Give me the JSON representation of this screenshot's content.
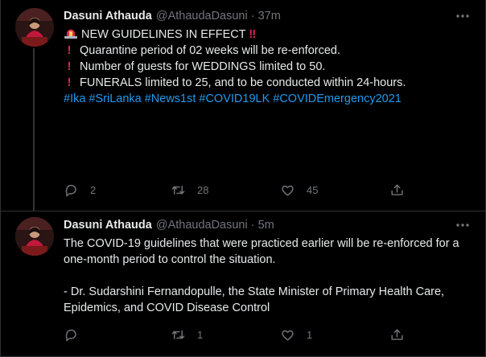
{
  "tweets": [
    {
      "author_name": "Dasuni Athauda",
      "author_handle": "@AthaudaDasuni",
      "separator": "·",
      "time": "37m",
      "headline_emoji_left": "siren-icon",
      "headline": "NEW GUIDELINES IN EFFECT",
      "headline_emoji_right": "double-exclamation-icon",
      "bullets": [
        "Quarantine period of 02 weeks will be re-enforced.",
        "Number of guests for WEDDINGS limited to 50.",
        "FUNERALS limited to 25, and to be conducted within 24-hours."
      ],
      "hashtags": [
        "#Ika",
        "#SriLanka",
        "#News1st",
        "#COVID19LK",
        "#COVIDEmergency2021"
      ],
      "reply_count": "2",
      "retweet_count": "28",
      "like_count": "45"
    },
    {
      "author_name": "Dasuni Athauda",
      "author_handle": "@AthaudaDasuni",
      "separator": "·",
      "time": "5m",
      "paragraph1": "The COVID-19 guidelines that were practiced earlier will be re-enforced for a one-month period to control the situation.",
      "paragraph2": "- Dr. Sudarshini Fernandopulle, the State Minister of Primary Health Care, Epidemics, and COVID Disease Control",
      "reply_count": "",
      "retweet_count": "1",
      "like_count": "1"
    }
  ],
  "colors": {
    "background": "#000000",
    "text": "#e7e9ea",
    "muted": "#71767b",
    "link": "#1d9bf0",
    "border": "#2f3336",
    "alert": "#e0245e"
  }
}
